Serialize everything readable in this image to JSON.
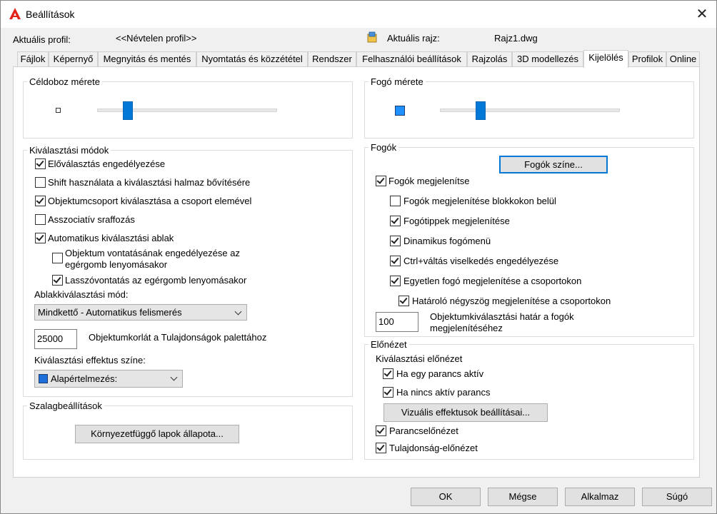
{
  "window": {
    "title": "Beállítások",
    "close_icon": "close-icon"
  },
  "profile": {
    "profile_label": "Aktuális profil:",
    "profile_value": "<<Névtelen profil>>",
    "drawing_label": "Aktuális rajz:",
    "drawing_value": "Rajz1.dwg"
  },
  "tabs": [
    {
      "label": "Fájlok"
    },
    {
      "label": "Képernyő"
    },
    {
      "label": "Megnyitás és mentés"
    },
    {
      "label": "Nyomtatás és közzététel"
    },
    {
      "label": "Rendszer"
    },
    {
      "label": "Felhasználói beállítások"
    },
    {
      "label": "Rajzolás"
    },
    {
      "label": "3D modellezés"
    },
    {
      "label": "Kijelölés",
      "active": true
    },
    {
      "label": "Profilok"
    },
    {
      "label": "Online"
    }
  ],
  "pickbox": {
    "title": "Céldoboz mérete",
    "slider_level": 0.17
  },
  "grip_size": {
    "title": "Fogó mérete",
    "slider_level": 0.22,
    "preview_color": "#1e90ff"
  },
  "selection_modes": {
    "title": "Kiválasztási módok",
    "options": [
      {
        "label": "Előválasztás engedélyezése",
        "checked": true
      },
      {
        "label": "Shift használata a kiválasztási halmaz bővítésére",
        "checked": false
      },
      {
        "label": "Objektumcsoport kiválasztása a csoport elemével",
        "checked": true
      },
      {
        "label": "Asszociatív sraffozás",
        "checked": false
      },
      {
        "label": "Automatikus kiválasztási ablak",
        "checked": true
      },
      {
        "label_line1": "Objektum vontatásának engedélyezése az",
        "label_line2": "egérgomb lenyomásakor",
        "checked": false
      },
      {
        "label": "Lasszóvontatás az egérgomb lenyomásakor",
        "checked": true
      }
    ],
    "window_mode_label": "Ablakkiválasztási mód:",
    "window_mode_value": "Mindkettő - Automatikus felismerés",
    "object_limit_value": "25000",
    "object_limit_label": "Objektumkorlát a Tulajdonságok palettához",
    "effect_color_label": "Kiválasztási effektus színe:",
    "effect_color_value": "Alapértelmezés:",
    "effect_color_swatch": "#1e6fd9"
  },
  "ribbon": {
    "title": "Szalagbeállítások",
    "button": "Környezetfüggő lapok állapota..."
  },
  "grips": {
    "title": "Fogók",
    "color_button": "Fogók színe...",
    "options": [
      {
        "label": "Fogók megjelenítse",
        "checked": true
      },
      {
        "label": "Fogók megjelenítése blokkokon belül",
        "checked": false
      },
      {
        "label": "Fogótippek megjelenítése",
        "checked": true
      },
      {
        "label": "Dinamikus fogómenü",
        "checked": true
      },
      {
        "label": "Ctrl+váltás viselkedés engedélyezése",
        "checked": true
      },
      {
        "label": "Egyetlen fogó megjelenítése a csoportokon",
        "checked": true
      },
      {
        "label": "Határoló négyszög megjelenítése a csoportokon",
        "checked": true
      }
    ],
    "limit_value": "100",
    "limit_label_line1": "Objektumkiválasztási határ a fogók",
    "limit_label_line2": "megjelenítéséhez"
  },
  "preview": {
    "title": "Előnézet",
    "subtitle": "Kiválasztási előnézet",
    "options": [
      {
        "label": "Ha egy parancs aktív",
        "checked": true
      },
      {
        "label": "Ha nincs aktív parancs",
        "checked": true
      }
    ],
    "visual_button": "Vizuális effektusok beállításai...",
    "command_preview": {
      "label": "Parancselőnézet",
      "checked": true
    },
    "property_preview": {
      "label": "Tulajdonság-előnézet",
      "checked": true
    }
  },
  "footer": {
    "ok": "OK",
    "cancel": "Mégse",
    "apply": "Alkalmaz",
    "help": "Súgó"
  }
}
